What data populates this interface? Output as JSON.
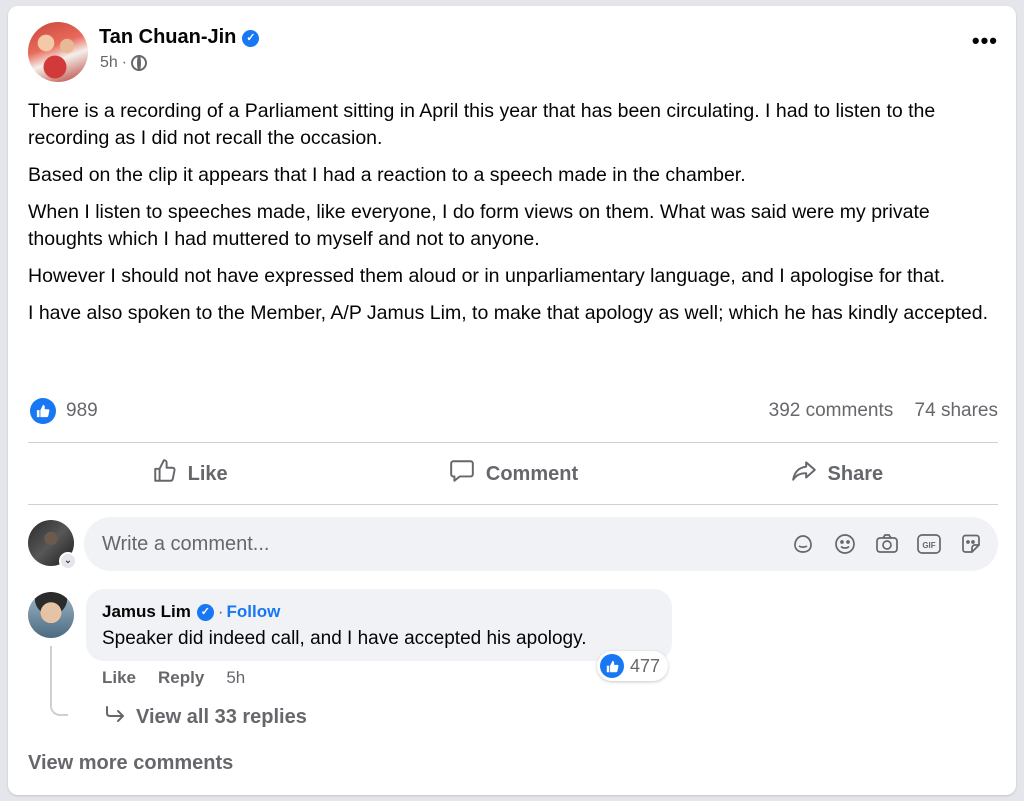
{
  "post": {
    "author": "Tan Chuan-Jin",
    "time": "5h",
    "separator": "·",
    "paragraphs": [
      "There is a recording of a Parliament sitting in April this year that has been circulating. I had to listen to the recording as I did not recall the occasion.",
      "Based on the clip it appears that I had a reaction to a speech made in the chamber.",
      "When I listen to speeches made, like everyone, I do form views on them. What was said were my private thoughts which I had muttered to myself and not to anyone.",
      "However I should not have expressed them aloud or in unparliamentary language, and I apologise for that.",
      "I have also spoken to the Member, A/P Jamus Lim, to make that apology as well; which he has kindly accepted."
    ]
  },
  "stats": {
    "likes": "989",
    "comments": "392 comments",
    "shares": "74 shares"
  },
  "actions": {
    "like": "Like",
    "comment": "Comment",
    "share": "Share"
  },
  "composer": {
    "placeholder": "Write a comment..."
  },
  "comment": {
    "author": "Jamus Lim",
    "separator": "·",
    "follow": "Follow",
    "text": "Speaker did indeed call, and I have accepted his apology.",
    "reactions": "477",
    "like": "Like",
    "reply": "Reply",
    "time": "5h",
    "view_replies": "View all 33 replies"
  },
  "view_more": "View more comments",
  "colors": {
    "brand": "#1877f2",
    "muted_text": "#65676b",
    "bubble_bg": "#f0f2f5"
  },
  "icons": [
    "verified-badge-icon",
    "globe-icon",
    "more-options-icon",
    "like-reaction-icon",
    "thumbs-up-icon",
    "comment-icon",
    "share-icon",
    "sticker-icon",
    "emoji-icon",
    "camera-icon",
    "gif-icon",
    "avatar-sticker-icon",
    "chevron-down-icon",
    "reply-arrow-icon"
  ]
}
